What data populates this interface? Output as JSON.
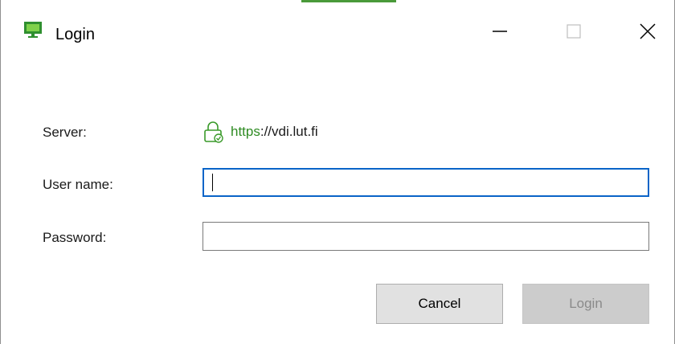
{
  "window": {
    "title": "Login",
    "accent_color": "#4a9a3a"
  },
  "icons": {
    "app": "monitor-icon",
    "lock": "lock-icon",
    "minimize": "minimize-icon",
    "maximize": "maximize-icon",
    "close": "close-icon"
  },
  "form": {
    "server_label": "Server:",
    "server_scheme": "https",
    "server_rest": "://vdi.lut.fi",
    "username_label": "User name:",
    "username_value": "",
    "password_label": "Password:",
    "password_value": ""
  },
  "buttons": {
    "cancel": "Cancel",
    "login": "Login"
  },
  "colors": {
    "secure_green": "#2e8b22",
    "focus_blue": "#0a64c8",
    "disabled_text": "#8a8a8a"
  }
}
